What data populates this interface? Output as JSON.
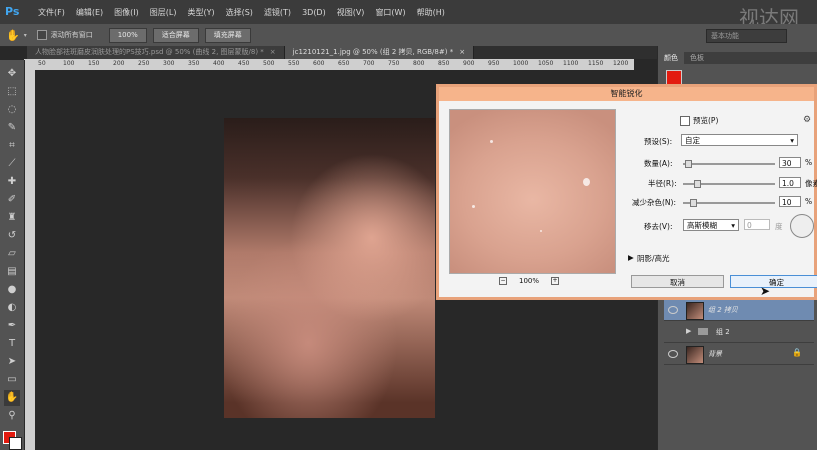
{
  "app": {
    "logo": "Ps",
    "watermark": "视达网"
  },
  "menubar": {
    "items": [
      "文件(F)",
      "编辑(E)",
      "图像(I)",
      "图层(L)",
      "类型(Y)",
      "选择(S)",
      "滤镜(T)",
      "3D(D)",
      "视图(V)",
      "窗口(W)",
      "帮助(H)"
    ]
  },
  "options": {
    "scroll_all": "滚动所有窗口",
    "zoom100": "100%",
    "fit_screen": "适合屏幕",
    "fill_screen": "填充屏幕",
    "workspace": "基本功能"
  },
  "tabs": [
    {
      "label": "人物脸部祛斑磨皮润肤处理的PS技巧.psd @ 50% (曲线 2, 图层蒙版/8) *"
    },
    {
      "label": "jc1210121_1.jpg @ 50% (组 2 拷贝, RGB/8#) *"
    }
  ],
  "ruler": {
    "ticks": [
      "50",
      "100",
      "150",
      "200",
      "250",
      "300",
      "350",
      "400",
      "450",
      "500",
      "550",
      "600",
      "650",
      "700",
      "750",
      "800",
      "850",
      "900",
      "950",
      "1000",
      "1050",
      "1100",
      "1150",
      "1200"
    ]
  },
  "panels": {
    "tabs": [
      "颜色",
      "色板"
    ],
    "layers": [
      {
        "name": "组 2 拷贝",
        "selected": true,
        "type": "layer"
      },
      {
        "name": "组 2",
        "selected": false,
        "type": "group"
      },
      {
        "name": "背景",
        "selected": false,
        "type": "layer"
      }
    ]
  },
  "dialog": {
    "title": "智能锐化",
    "preview_label": "预览(P)",
    "preset_label": "预设(S):",
    "preset_value": "自定",
    "amount_label": "数量(A):",
    "amount_value": "30",
    "amount_unit": "%",
    "radius_label": "半径(R):",
    "radius_value": "1.0",
    "radius_unit": "像素",
    "noise_label": "减少杂色(N):",
    "noise_value": "10",
    "noise_unit": "%",
    "remove_label": "移去(V):",
    "remove_value": "高斯模糊",
    "angle_value": "0",
    "angle_unit": "度",
    "shadow_highlight": "阴影/高光",
    "zoom": "100%",
    "cancel": "取消",
    "ok": "确定"
  },
  "colors": {
    "foreground": "#e31b0f",
    "background": "#ffffff",
    "dialog_accent": "#f6b48b"
  }
}
